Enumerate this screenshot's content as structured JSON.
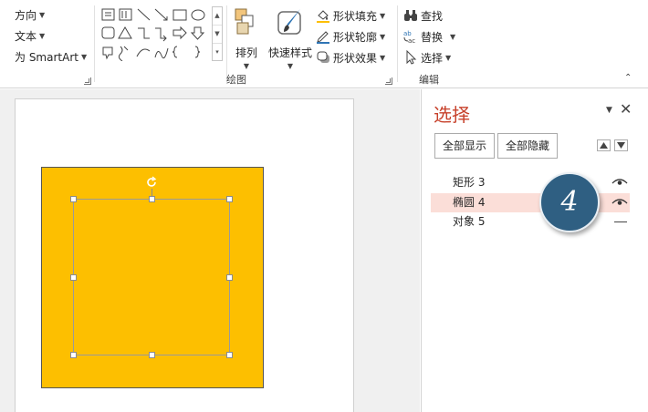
{
  "ribbon": {
    "paragraph": {
      "direction_label": "方向",
      "text_label": "文本",
      "smartart_label": "为 SmartArt"
    },
    "drawing": {
      "group_label": "绘图",
      "arrange_label": "排列",
      "quick_styles_label": "快速样式",
      "shape_fill_label": "形状填充",
      "shape_outline_label": "形状轮廓",
      "shape_effects_label": "形状效果"
    },
    "editing": {
      "group_label": "编辑",
      "find_label": "查找",
      "replace_label": "替换",
      "select_label": "选择"
    },
    "colors": {
      "fill_accent": "#fdbf00",
      "outline_accent": "#2f75b5"
    }
  },
  "slide": {
    "rectangle_fill": "#fdbf00"
  },
  "selection_pane": {
    "title": "选择",
    "title_color": "#c7412b",
    "show_all_label": "全部显示",
    "hide_all_label": "全部隐藏",
    "objects": [
      {
        "name": "矩形 3",
        "visibility": "visible",
        "selected": false
      },
      {
        "name": "椭圆 4",
        "visibility": "visible",
        "selected": true
      },
      {
        "name": "对象 5",
        "visibility": "hidden",
        "selected": false
      }
    ]
  },
  "step_badge": {
    "number": "4",
    "color": "#2f5f82"
  }
}
